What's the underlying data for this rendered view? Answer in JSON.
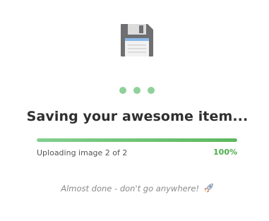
{
  "dialog": {
    "title": "Saving your awesome item...",
    "status": "Uploading image 2 of 2",
    "percent_label": "100%",
    "progress": 1.0,
    "note": "Almost done - don't go anywhere!",
    "icons": {
      "main": "floppy-disk-icon",
      "note": "rocket-icon"
    },
    "colors": {
      "accent": "#5cb85c",
      "dots": "#8fd19a",
      "title": "#2f2f2f"
    }
  }
}
